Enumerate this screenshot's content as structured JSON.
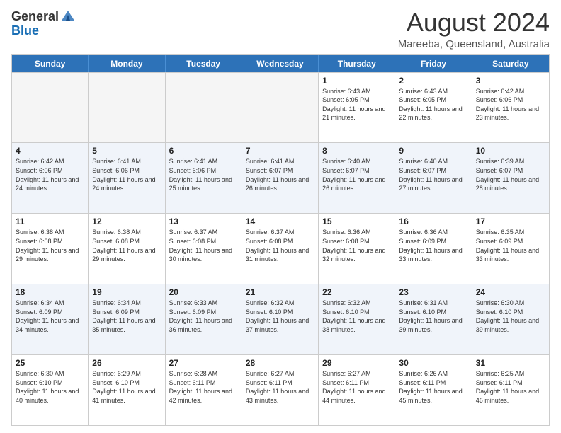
{
  "logo": {
    "general": "General",
    "blue": "Blue"
  },
  "title": "August 2024",
  "subtitle": "Mareeba, Queensland, Australia",
  "days_of_week": [
    "Sunday",
    "Monday",
    "Tuesday",
    "Wednesday",
    "Thursday",
    "Friday",
    "Saturday"
  ],
  "weeks": [
    [
      {
        "day": "",
        "empty": true
      },
      {
        "day": "",
        "empty": true
      },
      {
        "day": "",
        "empty": true
      },
      {
        "day": "",
        "empty": true
      },
      {
        "day": "1",
        "sunrise": "6:43 AM",
        "sunset": "6:05 PM",
        "daylight": "11 hours and 21 minutes."
      },
      {
        "day": "2",
        "sunrise": "6:43 AM",
        "sunset": "6:05 PM",
        "daylight": "11 hours and 22 minutes."
      },
      {
        "day": "3",
        "sunrise": "6:42 AM",
        "sunset": "6:06 PM",
        "daylight": "11 hours and 23 minutes."
      }
    ],
    [
      {
        "day": "4",
        "sunrise": "6:42 AM",
        "sunset": "6:06 PM",
        "daylight": "11 hours and 24 minutes."
      },
      {
        "day": "5",
        "sunrise": "6:41 AM",
        "sunset": "6:06 PM",
        "daylight": "11 hours and 24 minutes."
      },
      {
        "day": "6",
        "sunrise": "6:41 AM",
        "sunset": "6:06 PM",
        "daylight": "11 hours and 25 minutes."
      },
      {
        "day": "7",
        "sunrise": "6:41 AM",
        "sunset": "6:07 PM",
        "daylight": "11 hours and 26 minutes."
      },
      {
        "day": "8",
        "sunrise": "6:40 AM",
        "sunset": "6:07 PM",
        "daylight": "11 hours and 26 minutes."
      },
      {
        "day": "9",
        "sunrise": "6:40 AM",
        "sunset": "6:07 PM",
        "daylight": "11 hours and 27 minutes."
      },
      {
        "day": "10",
        "sunrise": "6:39 AM",
        "sunset": "6:07 PM",
        "daylight": "11 hours and 28 minutes."
      }
    ],
    [
      {
        "day": "11",
        "sunrise": "6:38 AM",
        "sunset": "6:08 PM",
        "daylight": "11 hours and 29 minutes."
      },
      {
        "day": "12",
        "sunrise": "6:38 AM",
        "sunset": "6:08 PM",
        "daylight": "11 hours and 29 minutes."
      },
      {
        "day": "13",
        "sunrise": "6:37 AM",
        "sunset": "6:08 PM",
        "daylight": "11 hours and 30 minutes."
      },
      {
        "day": "14",
        "sunrise": "6:37 AM",
        "sunset": "6:08 PM",
        "daylight": "11 hours and 31 minutes."
      },
      {
        "day": "15",
        "sunrise": "6:36 AM",
        "sunset": "6:08 PM",
        "daylight": "11 hours and 32 minutes."
      },
      {
        "day": "16",
        "sunrise": "6:36 AM",
        "sunset": "6:09 PM",
        "daylight": "11 hours and 33 minutes."
      },
      {
        "day": "17",
        "sunrise": "6:35 AM",
        "sunset": "6:09 PM",
        "daylight": "11 hours and 33 minutes."
      }
    ],
    [
      {
        "day": "18",
        "sunrise": "6:34 AM",
        "sunset": "6:09 PM",
        "daylight": "11 hours and 34 minutes."
      },
      {
        "day": "19",
        "sunrise": "6:34 AM",
        "sunset": "6:09 PM",
        "daylight": "11 hours and 35 minutes."
      },
      {
        "day": "20",
        "sunrise": "6:33 AM",
        "sunset": "6:09 PM",
        "daylight": "11 hours and 36 minutes."
      },
      {
        "day": "21",
        "sunrise": "6:32 AM",
        "sunset": "6:10 PM",
        "daylight": "11 hours and 37 minutes."
      },
      {
        "day": "22",
        "sunrise": "6:32 AM",
        "sunset": "6:10 PM",
        "daylight": "11 hours and 38 minutes."
      },
      {
        "day": "23",
        "sunrise": "6:31 AM",
        "sunset": "6:10 PM",
        "daylight": "11 hours and 39 minutes."
      },
      {
        "day": "24",
        "sunrise": "6:30 AM",
        "sunset": "6:10 PM",
        "daylight": "11 hours and 39 minutes."
      }
    ],
    [
      {
        "day": "25",
        "sunrise": "6:30 AM",
        "sunset": "6:10 PM",
        "daylight": "11 hours and 40 minutes."
      },
      {
        "day": "26",
        "sunrise": "6:29 AM",
        "sunset": "6:10 PM",
        "daylight": "11 hours and 41 minutes."
      },
      {
        "day": "27",
        "sunrise": "6:28 AM",
        "sunset": "6:11 PM",
        "daylight": "11 hours and 42 minutes."
      },
      {
        "day": "28",
        "sunrise": "6:27 AM",
        "sunset": "6:11 PM",
        "daylight": "11 hours and 43 minutes."
      },
      {
        "day": "29",
        "sunrise": "6:27 AM",
        "sunset": "6:11 PM",
        "daylight": "11 hours and 44 minutes."
      },
      {
        "day": "30",
        "sunrise": "6:26 AM",
        "sunset": "6:11 PM",
        "daylight": "11 hours and 45 minutes."
      },
      {
        "day": "31",
        "sunrise": "6:25 AM",
        "sunset": "6:11 PM",
        "daylight": "11 hours and 46 minutes."
      }
    ]
  ]
}
